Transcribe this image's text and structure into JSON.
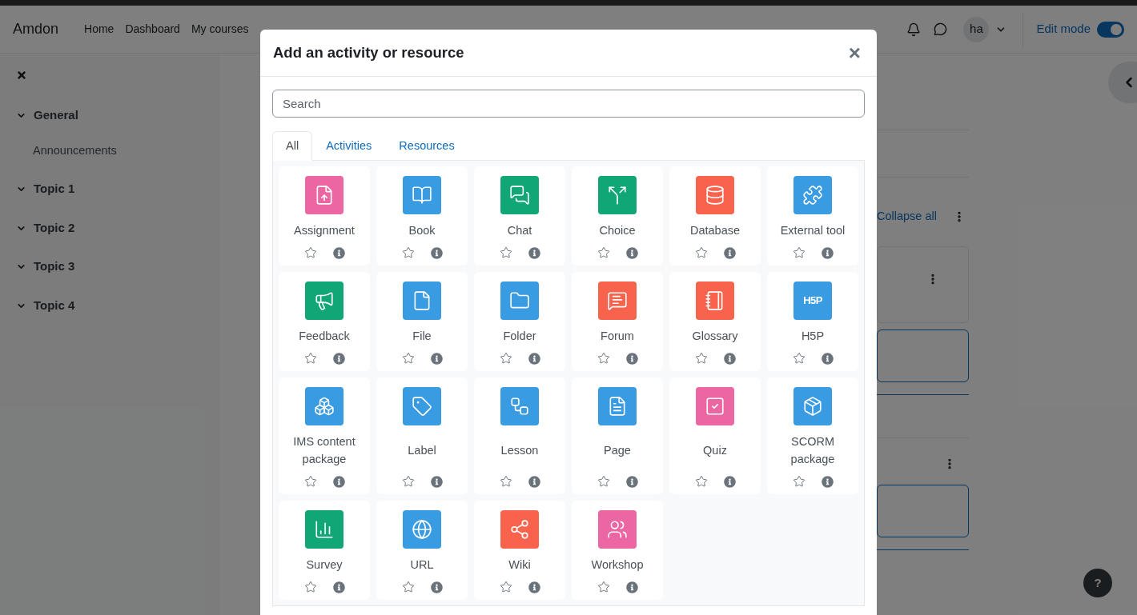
{
  "navbar": {
    "brand": "Amdon",
    "links": [
      "Home",
      "Dashboard",
      "My courses"
    ],
    "avatar": "ha",
    "edit_mode": {
      "label": "Edit mode",
      "on": true
    }
  },
  "sidebar": {
    "items": [
      {
        "label": "General",
        "expanded": true,
        "children": [
          {
            "label": "Announcements"
          }
        ]
      },
      {
        "label": "Topic 1",
        "expanded": true
      },
      {
        "label": "Topic 2",
        "expanded": true
      },
      {
        "label": "Topic 3",
        "expanded": true
      },
      {
        "label": "Topic 4",
        "expanded": true
      }
    ]
  },
  "course": {
    "collapse_link": "Collapse all",
    "help": "?"
  },
  "dialog": {
    "title": "Add an activity or resource",
    "close": "×",
    "search": {
      "placeholder": "Search"
    },
    "tabs": [
      {
        "label": "All",
        "selected": true
      },
      {
        "label": "Activities",
        "selected": false
      },
      {
        "label": "Resources",
        "selected": false
      }
    ],
    "items": [
      {
        "label": "Assignment",
        "color": "#eb66a2",
        "starred": false
      },
      {
        "label": "Book",
        "color": "#399be2",
        "starred": false
      },
      {
        "label": "Chat",
        "color": "#11a676",
        "starred": false
      },
      {
        "label": "Choice",
        "color": "#11a676",
        "starred": false
      },
      {
        "label": "Database",
        "color": "#f7634d",
        "starred": false
      },
      {
        "label": "External tool",
        "color": "#399be2",
        "starred": false
      },
      {
        "label": "Feedback",
        "color": "#11a676",
        "starred": false
      },
      {
        "label": "File",
        "color": "#399be2",
        "starred": false
      },
      {
        "label": "Folder",
        "color": "#399be2",
        "starred": false
      },
      {
        "label": "Forum",
        "color": "#f7634d",
        "starred": false
      },
      {
        "label": "Glossary",
        "color": "#f7634d",
        "starred": false
      },
      {
        "label": "H5P",
        "color": "#399be2",
        "starred": false,
        "icon_text": "H5P"
      },
      {
        "label": "IMS content package",
        "color": "#399be2",
        "starred": false
      },
      {
        "label": "Label",
        "color": "#399be2",
        "starred": false
      },
      {
        "label": "Lesson",
        "color": "#399be2",
        "starred": false
      },
      {
        "label": "Page",
        "color": "#399be2",
        "starred": false
      },
      {
        "label": "Quiz",
        "color": "#eb66a2",
        "starred": false
      },
      {
        "label": "SCORM package",
        "color": "#399be2",
        "starred": false
      },
      {
        "label": "Survey",
        "color": "#11a676",
        "starred": false
      },
      {
        "label": "URL",
        "color": "#399be2",
        "starred": false
      },
      {
        "label": "Wiki",
        "color": "#f7634d",
        "starred": false
      },
      {
        "label": "Workshop",
        "color": "#eb66a2",
        "starred": false
      }
    ]
  }
}
